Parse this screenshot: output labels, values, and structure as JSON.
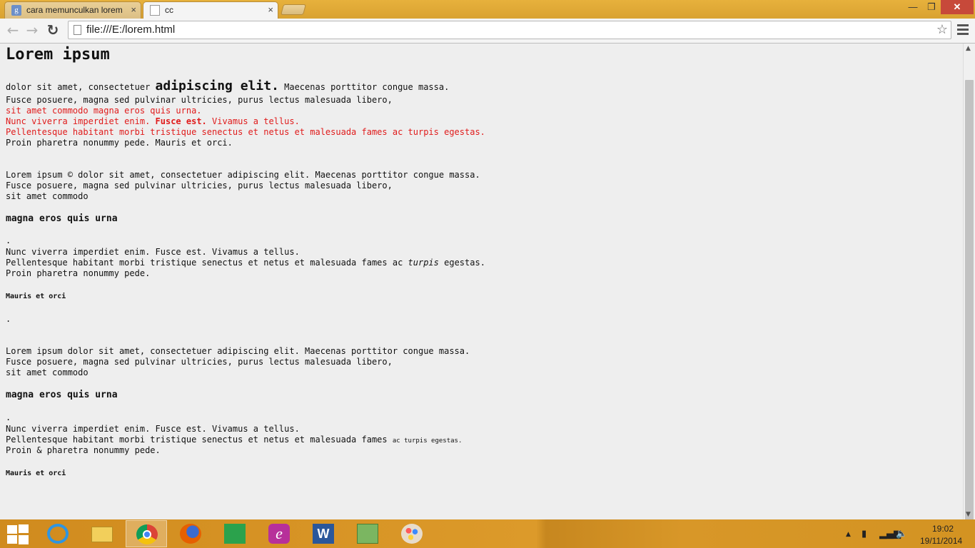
{
  "browser": {
    "tabs": [
      {
        "title": "cara memunculkan lorem",
        "close": "×",
        "favicon": "g"
      },
      {
        "title": "cc",
        "close": "×"
      }
    ],
    "url": "file:///E:/lorem.html",
    "window": {
      "minimize": "—",
      "maximize": "❐",
      "close": "✕"
    },
    "nav": {
      "back": "←",
      "forward": "→",
      "reload": "↻",
      "star": "☆"
    }
  },
  "page": {
    "title": "Lorem ipsum",
    "p1": {
      "l1a": " dolor sit amet, consectetuer ",
      "l1big": "adipiscing elit.",
      "l1c": " Maecenas porttitor congue massa.",
      "l2": "Fusce posuere, magna sed pulvinar ultricies, purus lectus malesuada libero,",
      "l3": "sit amet commodo magna eros quis urna.",
      "l4a": "Nunc viverra imperdiet enim. ",
      "l4b": "Fusce est.",
      "l4c": " Vivamus a tellus.",
      "l5": "Pellentesque habitant morbi tristique senectus et netus et malesuada fames ac turpis egestas.",
      "l6": "Proin pharetra nonummy pede. Mauris et orci."
    },
    "p2": {
      "l1": "Lorem ipsum © dolor sit amet, consectetuer adipiscing elit. Maecenas porttitor congue massa.",
      "l2": "Fusce posuere, magna sed pulvinar ultricies, purus lectus malesuada libero,",
      "l3": "sit amet commodo",
      "h": "magna eros quis urna",
      "dot": ".",
      "l4": "Nunc viverra imperdiet enim. Fusce est. Vivamus a tellus.",
      "l5a": "Pellentesque habitant morbi tristique senectus et netus et malesuada fames ac ",
      "l5b": "turpis",
      "l5c": " egestas.",
      "l6": "Proin pharetra nonummy pede.",
      "small": "Mauris et orci",
      "dot2": "."
    },
    "p3": {
      "l1": "Lorem ipsum dolor sit amet, consectetuer adipiscing elit. Maecenas porttitor congue massa.",
      "l2": "Fusce posuere, magna sed pulvinar ultricies, purus lectus malesuada libero,",
      "l3": "sit amet commodo",
      "h": "magna eros quis urna",
      "dot": ".",
      "l4": "Nunc viverra imperdiet enim. Fusce est. Vivamus a tellus.",
      "l5a": "Pellentesque habitant morbi tristique senectus et netus et malesuada fames ",
      "l5b": "ac turpis egestas.",
      "l6": "Proin & pharetra nonummy pede.",
      "small": "Mauris et orci"
    }
  },
  "taskbar": {
    "apps": [
      "internet-explorer",
      "file-explorer",
      "chrome",
      "firefox",
      "store",
      "corel",
      "word",
      "notepad",
      "paint"
    ],
    "tray": {
      "arrow": "▲",
      "time": "19:02",
      "date": "19/11/2014"
    }
  },
  "colors": {
    "accent": "#d9a231",
    "red_text": "#e01b1b",
    "page_bg": "#eeeeee"
  }
}
